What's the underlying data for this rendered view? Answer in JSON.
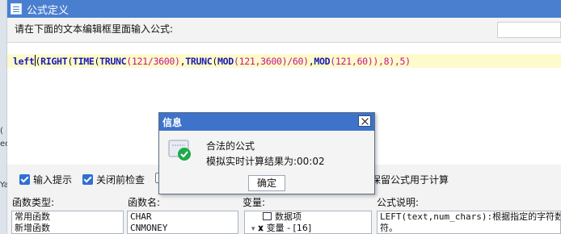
{
  "window": {
    "title": "公式定义"
  },
  "instruction": "请在下面的文本编辑框里面输入公式:",
  "formula": {
    "t1": "left",
    "t2": "(",
    "t3": "RIGHT",
    "t4": "(",
    "t5": "TIME",
    "t6": "(",
    "t7": "TRUNC",
    "t8": "(121/3600)",
    "t9": ",",
    "t10": "TRUNC",
    "t11": "(",
    "t12": "MOD",
    "t13": "(121,3600)/60)",
    "t14": ",",
    "t15": "MOD",
    "t16": "(121,60))",
    "t17": ",8),5)"
  },
  "options": {
    "input_hint": "输入提示",
    "close_check": "关闭前检查",
    "keep_formula": "保留公式用于计算"
  },
  "labels": {
    "func_type": "函数类型:",
    "func_name": "函数名:",
    "variable": "变量:",
    "formula_desc": "公式说明:"
  },
  "func_types": [
    "常用函数",
    "新增函数"
  ],
  "func_names": [
    "CHAR",
    "CNMONEY"
  ],
  "var_items": [
    "数据项",
    "变量 - [16]"
  ],
  "description": "LEFT(text,num_chars):根据指定的字符数...",
  "description_line2": "符。",
  "left_strip": [
    "(",
    "ec",
    "Ya"
  ],
  "dialog": {
    "title": "信息",
    "message1": "合法的公式",
    "message2": "模拟实时计算结果为:00:02",
    "ok_label": "确定"
  },
  "colors": {
    "titlebar": "#4a7fd0",
    "highlight": "#fdfacc",
    "function": "#1a1ab4",
    "number": "#c01a8a"
  }
}
